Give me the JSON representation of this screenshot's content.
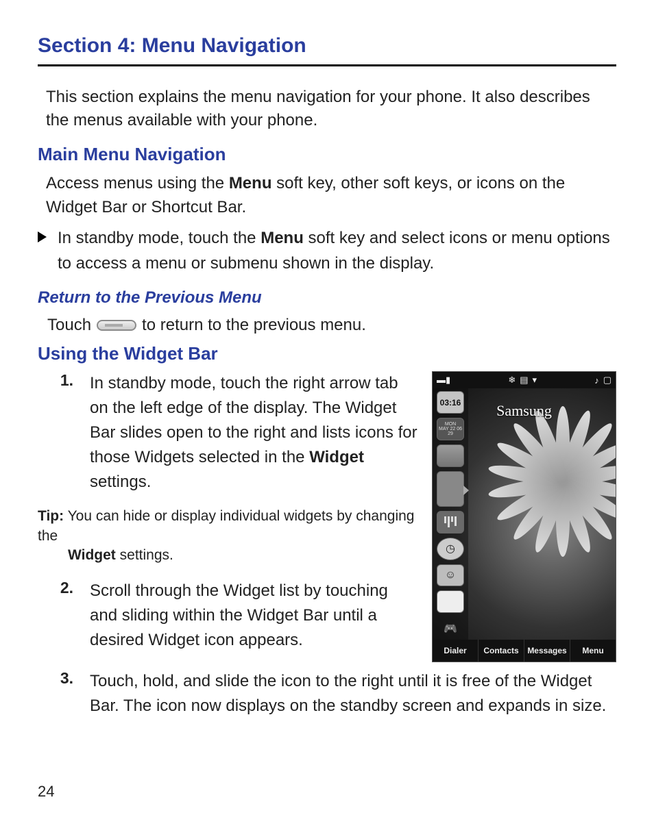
{
  "page_number": "24",
  "section_title": "Section 4: Menu Navigation",
  "intro": "This section explains the menu navigation for your phone. It also describes the menus available with your phone.",
  "main_menu": {
    "heading": "Main Menu Navigation",
    "p1_a": "Access menus using the ",
    "p1_b": "Menu",
    "p1_c": " soft key, other soft keys, or icons on the Widget Bar or Shortcut Bar.",
    "bullet_a": "In standby mode, touch the ",
    "bullet_b": "Menu",
    "bullet_c": " soft key and select icons or menu options to access a menu or submenu shown in the display."
  },
  "return_menu": {
    "heading": "Return to the Previous Menu",
    "touch_a": "Touch",
    "touch_b": "to return to the previous menu."
  },
  "widget_bar": {
    "heading": "Using the Widget Bar",
    "items": [
      {
        "num": "1.",
        "text_a": "In standby mode, touch the right arrow tab on the left edge of the display. The Widget Bar slides open to the right and lists icons for those Widgets selected in the ",
        "text_b": "Widget",
        "text_c": " settings."
      },
      {
        "num": "2.",
        "text_a": "Scroll through the Widget list by touching and sliding within the Widget Bar until a desired Widget icon appears.",
        "text_b": "",
        "text_c": ""
      },
      {
        "num": "3.",
        "text_a": "Touch, hold, and slide the icon to the right until it is free of the Widget Bar. The icon now displays on the standby screen and expands in size.",
        "text_b": "",
        "text_c": ""
      }
    ],
    "tip_label": "Tip:",
    "tip_a": " You can hide or display individual widgets by changing the ",
    "tip_b": "Widget",
    "tip_c": " settings."
  },
  "phone": {
    "brand": "Samsung",
    "time": "03:16",
    "date_top": "MON",
    "date_bottom": "MAY 22 06 29",
    "softkeys": [
      "Dialer",
      "Contacts",
      "Messages",
      "Menu"
    ],
    "status_left": "▬▮",
    "status_mid_a": "❄",
    "status_mid_b": "▤",
    "status_right_a": "♪",
    "status_right_b": "▢"
  }
}
